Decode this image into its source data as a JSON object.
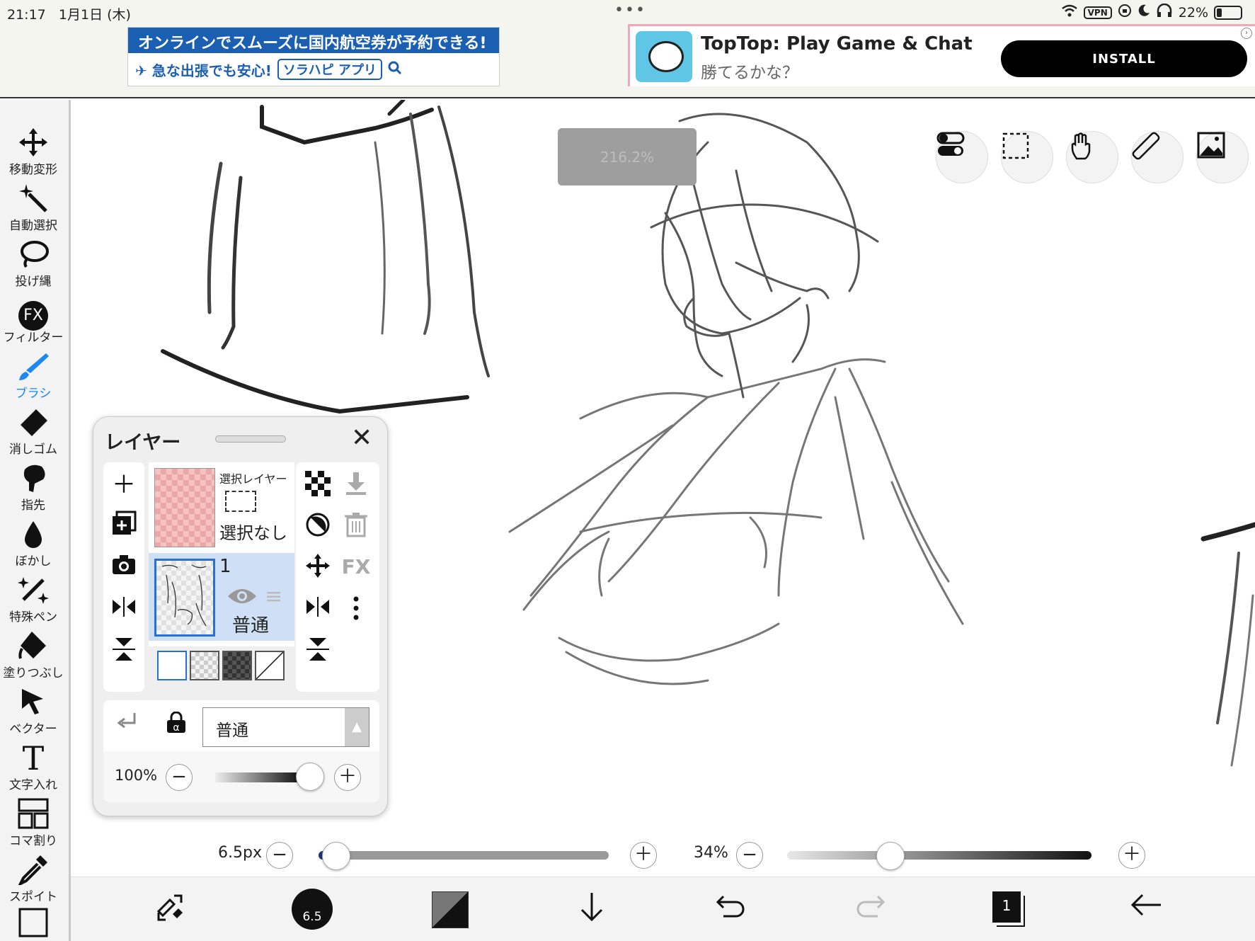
{
  "status": {
    "time": "21:17",
    "date": "1月1日 (木)",
    "dots": "•••",
    "vpn": "VPN",
    "battery": "22%"
  },
  "ads": {
    "left": {
      "headline": "オンラインでスムーズに国内航空券が予約できる!",
      "tagline": "✈ 急な出張でも安心!",
      "pill": "ソラハピ アプリ"
    },
    "right": {
      "title": "TopTop: Play Game & Chat",
      "subtitle": "勝てるかな？",
      "install": "INSTALL"
    }
  },
  "toolbar": {
    "items": [
      {
        "label": "移動変形",
        "icon": "move-icon"
      },
      {
        "label": "自動選択",
        "icon": "magic-wand-icon"
      },
      {
        "label": "投げ縄",
        "icon": "lasso-icon"
      },
      {
        "label": "フィルター",
        "icon": "fx-icon",
        "badge": "FX"
      },
      {
        "label": "ブラシ",
        "icon": "brush-icon"
      },
      {
        "label": "消しゴム",
        "icon": "eraser-icon"
      },
      {
        "label": "指先",
        "icon": "finger-icon"
      },
      {
        "label": "ぼかし",
        "icon": "blur-icon"
      },
      {
        "label": "特殊ペン",
        "icon": "special-pen-icon"
      },
      {
        "label": "塗りつぶし",
        "icon": "fill-icon"
      },
      {
        "label": "ベクター",
        "icon": "vector-icon"
      },
      {
        "label": "文字入れ",
        "icon": "text-icon"
      },
      {
        "label": "コマ割り",
        "icon": "frame-divider-icon"
      },
      {
        "label": "スポイト",
        "icon": "eyedropper-icon"
      }
    ],
    "active": "ブラシ"
  },
  "canvas": {
    "zoom": "216.2%"
  },
  "layer_panel": {
    "title": "レイヤー",
    "selection_layer": {
      "name": "選択レイヤー",
      "state": "選択なし"
    },
    "layer1": {
      "number": "1",
      "mode": "普通"
    },
    "blend_mode": "普通",
    "opacity": "100%",
    "opacity_value": 100,
    "fx": "FX"
  },
  "sliders": {
    "brush_size": "6.5px",
    "brush_size_fraction": 0.06,
    "brush_opacity": "34%",
    "brush_opacity_fraction": 0.34
  },
  "bottom": {
    "brush_size_badge": "6.5",
    "layer_count": "1"
  }
}
